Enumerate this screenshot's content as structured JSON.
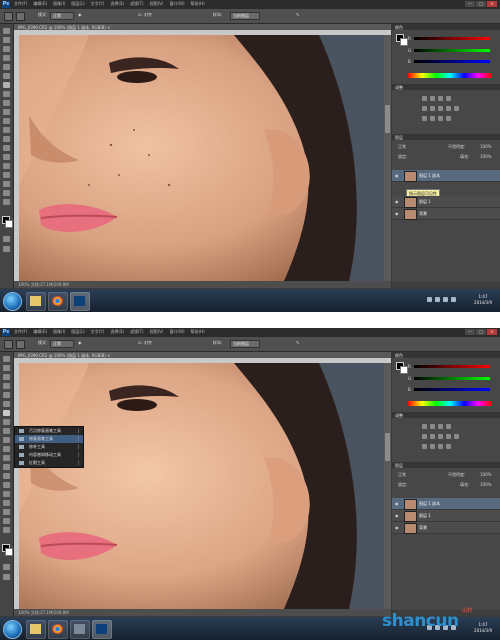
{
  "app": {
    "logo": "Ps"
  },
  "menu": [
    "文件(F)",
    "编辑(E)",
    "图像(I)",
    "图层(L)",
    "文字(Y)",
    "选择(S)",
    "滤镜(T)",
    "视图(V)",
    "窗口(W)",
    "帮助(H)"
  ],
  "window_buttons": [
    "—",
    "□",
    "✕"
  ],
  "top": {
    "options": {
      "mode_label": "模式:",
      "mode_value": "正常",
      "sample_label": "样本:",
      "sample_value": "当前图层",
      "align_label": "对齐"
    },
    "doc_tab": "IMG_0390.CR2 @ 100% (图层 1 副本, RGB/8) ×",
    "status": "100%   文档:37.1M/109.8M",
    "panel_tabs": {
      "color": "颜色",
      "adjust": "调整",
      "layers": "图层"
    },
    "color_sliders": [
      "R",
      "G",
      "B"
    ],
    "layers": {
      "blend_mode": "正常",
      "opacity_label": "不透明度:",
      "opacity": "100%",
      "lock_label": "锁定:",
      "fill_label": "填充:",
      "fill": "100%",
      "rows": [
        {
          "name": "图层 1 副本",
          "active": true
        },
        {
          "name": "图层 1",
          "active": false
        },
        {
          "name": "背景",
          "active": false
        }
      ],
      "tooltip": "指示图层可见性"
    },
    "clock": {
      "time": "1:47",
      "date": "2014/3/9"
    }
  },
  "bottom": {
    "options": {
      "mode_label": "模式:",
      "mode_value": "正常",
      "sample_label": "样本:",
      "sample_value": "当前图层",
      "align_label": "对齐"
    },
    "doc_tab": "IMG_0390.CR2 @ 100% (图层 1 副本, RGB/8) ×",
    "status": "100%   文档:37.1M/109.8M",
    "panel_tabs": {
      "color": "颜色",
      "adjust": "调整",
      "layers": "图层"
    },
    "color_sliders": [
      "R",
      "G",
      "B"
    ],
    "layers": {
      "blend_mode": "正常",
      "opacity_label": "不透明度:",
      "opacity": "100%",
      "lock_label": "锁定:",
      "fill_label": "填充:",
      "fill": "100%",
      "rows": [
        {
          "name": "图层 1 副本",
          "active": true
        },
        {
          "name": "图层 1",
          "active": false
        },
        {
          "name": "背景",
          "active": false
        }
      ]
    },
    "flyout": [
      {
        "label": "污点修复画笔工具",
        "key": "J",
        "selected": false
      },
      {
        "label": "修复画笔工具",
        "key": "J",
        "selected": true
      },
      {
        "label": "修补工具",
        "key": "J",
        "selected": false
      },
      {
        "label": "内容感知移动工具",
        "key": "J",
        "selected": false
      },
      {
        "label": "红眼工具",
        "key": "J",
        "selected": false
      }
    ],
    "clock": {
      "time": "1:47",
      "date": "2014/3/9"
    }
  },
  "watermark": {
    "text": "shancun",
    "sub": "山村"
  }
}
